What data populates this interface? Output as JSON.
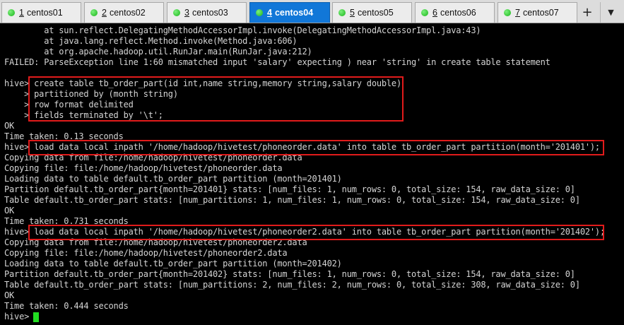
{
  "tabs": [
    {
      "num": "1",
      "label": "centos01",
      "active": false
    },
    {
      "num": "2",
      "label": "centos02",
      "active": false
    },
    {
      "num": "3",
      "label": "centos03",
      "active": false
    },
    {
      "num": "4",
      "label": "centos04",
      "active": true
    },
    {
      "num": "5",
      "label": "centos05",
      "active": false
    },
    {
      "num": "6",
      "label": "centos06",
      "active": false
    },
    {
      "num": "7",
      "label": "centos07",
      "active": false
    }
  ],
  "tab_add_label": "+",
  "tab_menu_label": "▼",
  "status_dot_color": "#2ecc40",
  "highlight_color": "#e11b1b",
  "cursor_color": "#22dd22",
  "terminal": {
    "lines": [
      "        at sun.reflect.DelegatingMethodAccessorImpl.invoke(DelegatingMethodAccessorImpl.java:43)",
      "        at java.lang.reflect.Method.invoke(Method.java:606)",
      "        at org.apache.hadoop.util.RunJar.main(RunJar.java:212)",
      "FAILED: ParseException line 1:60 mismatched input 'salary' expecting ) near 'string' in create table statement",
      "",
      "hive> create table tb_order_part(id int,name string,memory string,salary double)",
      "    > partitioned by (month string)",
      "    > row format delimited",
      "    > fields terminated by '\\t';",
      "OK",
      "Time taken: 0.13 seconds",
      "hive> load data local inpath '/home/hadoop/hivetest/phoneorder.data' into table tb_order_part partition(month='201401');",
      "Copying data from file:/home/hadoop/hivetest/phoneorder.data",
      "Copying file: file:/home/hadoop/hivetest/phoneorder.data",
      "Loading data to table default.tb_order_part partition (month=201401)",
      "Partition default.tb_order_part{month=201401} stats: [num_files: 1, num_rows: 0, total_size: 154, raw_data_size: 0]",
      "Table default.tb_order_part stats: [num_partitions: 1, num_files: 1, num_rows: 0, total_size: 154, raw_data_size: 0]",
      "OK",
      "Time taken: 0.731 seconds",
      "hive> load data local inpath '/home/hadoop/hivetest/phoneorder2.data' into table tb_order_part partition(month='201402');",
      "Copying data from file:/home/hadoop/hivetest/phoneorder2.data",
      "Copying file: file:/home/hadoop/hivetest/phoneorder2.data",
      "Loading data to table default.tb_order_part partition (month=201402)",
      "Partition default.tb_order_part{month=201402} stats: [num_files: 1, num_rows: 0, total_size: 154, raw_data_size: 0]",
      "Table default.tb_order_part stats: [num_partitions: 2, num_files: 2, num_rows: 0, total_size: 308, raw_data_size: 0]",
      "OK",
      "Time taken: 0.444 seconds",
      "hive> "
    ]
  }
}
